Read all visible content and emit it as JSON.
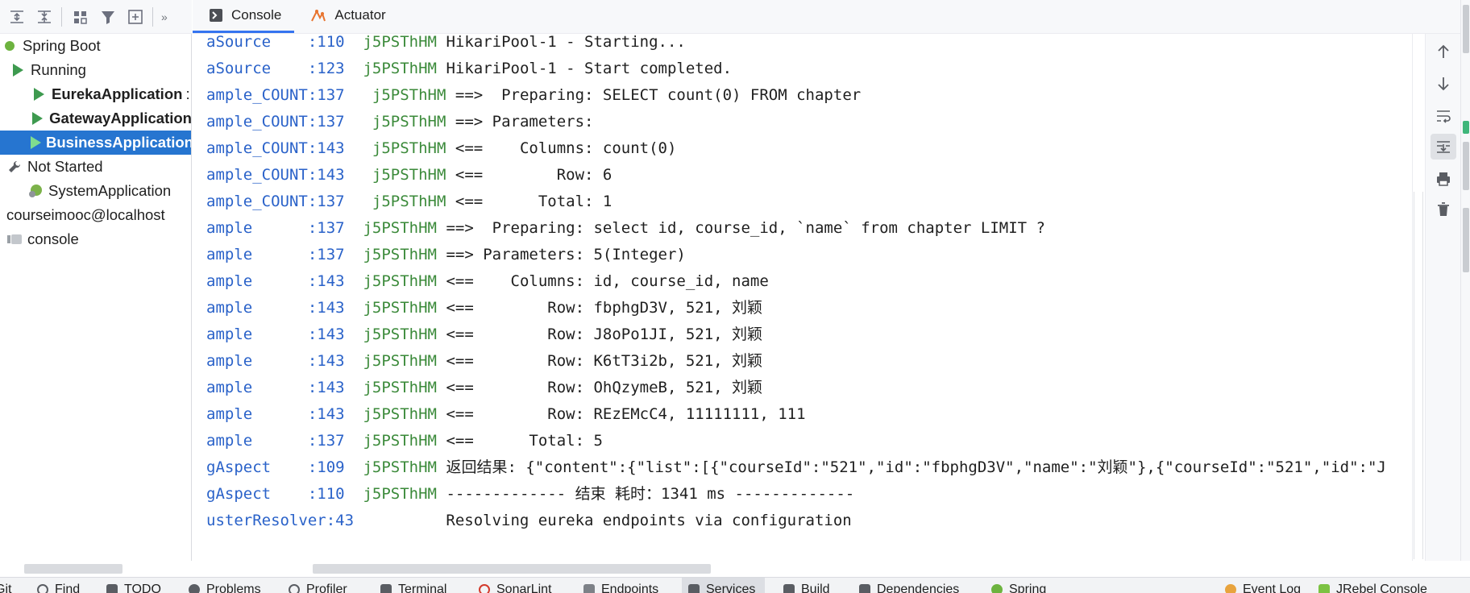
{
  "left_toolbar": {
    "icons": [
      "expand-all-icon",
      "collapse-all-icon",
      "group-by-icon",
      "filter-icon",
      "add-service-icon"
    ],
    "more": "»"
  },
  "tree": {
    "items": [
      {
        "label": "Spring Boot",
        "icon": "spring-leaf-icon"
      },
      {
        "label": "Running",
        "icon": "run-icon"
      },
      {
        "label": "EurekaApplication",
        "suffix": ":",
        "icon": "run-icon"
      },
      {
        "label": "GatewayApplication",
        "icon": "run-icon"
      },
      {
        "label": "BusinessApplication",
        "icon": "run-icon",
        "selected": true
      },
      {
        "label": "Not Started",
        "icon": "wrench-icon"
      },
      {
        "label": "SystemApplication",
        "icon": "spring-app-icon"
      },
      {
        "label": "courseimooc@localhost",
        "icon": "database-icon"
      },
      {
        "label": "console",
        "icon": "console-db-icon"
      }
    ]
  },
  "tabs": [
    {
      "label": "Console",
      "icon": "console-icon",
      "active": true
    },
    {
      "label": "Actuator",
      "icon": "actuator-icon",
      "active": false
    }
  ],
  "console": {
    "lines": [
      {
        "src": "aSource    :110",
        "thr": "j5PSThHM",
        "msg": " HikariPool-1 - Starting..."
      },
      {
        "src": "aSource    :123",
        "thr": "j5PSThHM",
        "msg": " HikariPool-1 - Start completed."
      },
      {
        "src": "ample_COUNT:137",
        "thr": " j5PSThHM",
        "msg": " ==>  Preparing: SELECT count(0) FROM chapter"
      },
      {
        "src": "ample_COUNT:137",
        "thr": " j5PSThHM",
        "msg": " ==> Parameters: "
      },
      {
        "src": "ample_COUNT:143",
        "thr": " j5PSThHM",
        "msg": " <==    Columns: count(0)"
      },
      {
        "src": "ample_COUNT:143",
        "thr": " j5PSThHM",
        "msg": " <==        Row: 6"
      },
      {
        "src": "ample_COUNT:137",
        "thr": " j5PSThHM",
        "msg": " <==      Total: 1"
      },
      {
        "src": "ample      :137",
        "thr": "j5PSThHM",
        "msg": " ==>  Preparing: select id, course_id, `name` from chapter LIMIT ?"
      },
      {
        "src": "ample      :137",
        "thr": "j5PSThHM",
        "msg": " ==> Parameters: 5(Integer)"
      },
      {
        "src": "ample      :143",
        "thr": "j5PSThHM",
        "msg": " <==    Columns: id, course_id, name"
      },
      {
        "src": "ample      :143",
        "thr": "j5PSThHM",
        "msg": " <==        Row: fbphgD3V, 521, 刘颖"
      },
      {
        "src": "ample      :143",
        "thr": "j5PSThHM",
        "msg": " <==        Row: J8oPo1JI, 521, 刘颖"
      },
      {
        "src": "ample      :143",
        "thr": "j5PSThHM",
        "msg": " <==        Row: K6tT3i2b, 521, 刘颖"
      },
      {
        "src": "ample      :143",
        "thr": "j5PSThHM",
        "msg": " <==        Row: OhQzymeB, 521, 刘颖"
      },
      {
        "src": "ample      :143",
        "thr": "j5PSThHM",
        "msg": " <==        Row: REzEMcC4, 11111111, 111"
      },
      {
        "src": "ample      :137",
        "thr": "j5PSThHM",
        "msg": " <==      Total: 5"
      },
      {
        "src": "gAspect    :109",
        "thr": "j5PSThHM",
        "msg": " 返回结果: {\"content\":{\"list\":[{\"courseId\":\"521\",\"id\":\"fbphgD3V\",\"name\":\"刘颖\"},{\"courseId\":\"521\",\"id\":\"J"
      },
      {
        "src": "gAspect    :110",
        "thr": "j5PSThHM",
        "msg": " ------------- 结束 耗时：1341 ms -------------"
      },
      {
        "src": "usterResolver:43",
        "thr": "",
        "msg": "          Resolving eureka endpoints via configuration"
      }
    ]
  },
  "right_actions": [
    {
      "icon": "arrow-up-icon"
    },
    {
      "icon": "arrow-down-icon"
    },
    {
      "icon": "soft-wrap-icon"
    },
    {
      "icon": "scroll-to-end-icon",
      "active": true
    },
    {
      "icon": "print-icon"
    },
    {
      "icon": "trash-icon"
    }
  ],
  "bottom_bar": {
    "items": [
      {
        "label": "Git",
        "icon": "git-icon"
      },
      {
        "label": "Find",
        "icon": "find-icon"
      },
      {
        "label": "TODO",
        "icon": "todo-icon"
      },
      {
        "label": "Problems",
        "icon": "problems-icon"
      },
      {
        "label": "Profiler",
        "icon": "profiler-icon"
      },
      {
        "label": "Terminal",
        "icon": "terminal-icon"
      },
      {
        "label": "SonarLint",
        "icon": "sonarlint-icon"
      },
      {
        "label": "Endpoints",
        "icon": "endpoints-icon"
      },
      {
        "label": "Services",
        "icon": "services-icon",
        "active": true
      },
      {
        "label": "Build",
        "icon": "build-icon"
      },
      {
        "label": "Dependencies",
        "icon": "dependencies-icon"
      },
      {
        "label": "Spring",
        "icon": "spring-icon"
      },
      {
        "label": "Event Log",
        "icon": "event-log-icon"
      },
      {
        "label": "JRebel Console",
        "icon": "jrebel-icon"
      }
    ]
  }
}
